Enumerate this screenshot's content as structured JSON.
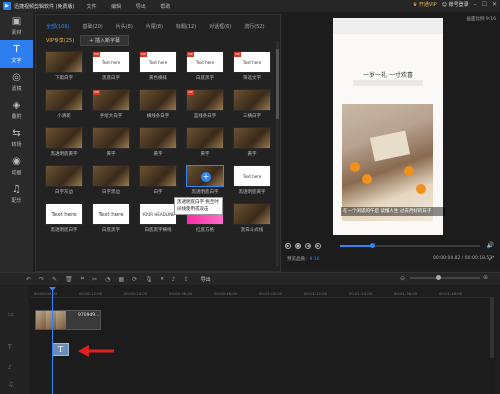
{
  "window": {
    "title": "迅捷视频剪辑软件 (免费版)",
    "menu": [
      "文件",
      "编辑",
      "导出",
      "帮助"
    ],
    "vip_label": "开通VIP",
    "login_label": "账号登录",
    "ratio_label": "画面比例 9:16"
  },
  "sidebar": {
    "items": [
      {
        "label": "素材",
        "icon": "folder-icon",
        "active": false
      },
      {
        "label": "文字",
        "icon": "text-icon",
        "active": true
      },
      {
        "label": "滤镜",
        "icon": "filter-icon",
        "active": false
      },
      {
        "label": "叠附",
        "icon": "overlay-icon",
        "active": false
      },
      {
        "label": "转场",
        "icon": "transition-icon",
        "active": false
      },
      {
        "label": "动画",
        "icon": "animation-icon",
        "active": false
      },
      {
        "label": "配乐",
        "icon": "music-icon",
        "active": false
      }
    ]
  },
  "panel": {
    "tabs": [
      {
        "label": "全部(106)",
        "active": true
      },
      {
        "label": "基础(20)",
        "active": false
      },
      {
        "label": "片头(8)",
        "active": false
      },
      {
        "label": "片尾(8)",
        "active": false
      },
      {
        "label": "标题(12)",
        "active": false
      },
      {
        "label": "对话框(6)",
        "active": false
      },
      {
        "label": "流行(52)",
        "active": false
      }
    ],
    "vip_chip": "VIP专享(25)",
    "add_button": "+ 插入新字幕",
    "items": [
      {
        "caption": "下雨白字",
        "style": "photo",
        "overlay": "",
        "vip": false
      },
      {
        "caption": "黑底白字",
        "style": "white",
        "overlay": "Text here",
        "vip": true
      },
      {
        "caption": "黄色横排",
        "style": "white",
        "overlay": "Text here",
        "vip": true
      },
      {
        "caption": "白底黑字",
        "style": "white",
        "overlay": "Text here",
        "vip": true
      },
      {
        "caption": "筛选文字",
        "style": "white",
        "overlay": "Text here",
        "vip": true
      },
      {
        "caption": "小清新",
        "style": "photo",
        "overlay": "",
        "vip": false
      },
      {
        "caption": "手绘大白字",
        "style": "photo",
        "overlay": "",
        "vip": true
      },
      {
        "caption": "横线条白字",
        "style": "photo",
        "overlay": "",
        "vip": false
      },
      {
        "caption": "蓝线条白字",
        "style": "photo",
        "overlay": "",
        "vip": true
      },
      {
        "caption": "三横白字",
        "style": "photo",
        "overlay": "",
        "vip": false
      },
      {
        "caption": "黑透明底黄字",
        "style": "photo",
        "overlay": "",
        "vip": false
      },
      {
        "caption": "黄字",
        "style": "photo",
        "overlay": "",
        "vip": false
      },
      {
        "caption": "黄字",
        "style": "photo",
        "overlay": "",
        "vip": false
      },
      {
        "caption": "黄字",
        "style": "photo",
        "overlay": "",
        "vip": false
      },
      {
        "caption": "黄字",
        "style": "photo",
        "overlay": "",
        "vip": false
      },
      {
        "caption": "白字灰边",
        "style": "photo",
        "overlay": "",
        "vip": false
      },
      {
        "caption": "白字黑边",
        "style": "photo",
        "overlay": "",
        "vip": false
      },
      {
        "caption": "白字",
        "style": "photo",
        "overlay": "",
        "vip": false
      },
      {
        "caption": "黑透明底白字",
        "style": "photo",
        "overlay": "",
        "vip": false,
        "selected": true
      },
      {
        "caption": "黑透明底黄字",
        "style": "white",
        "overlay": "Text here",
        "vip": false
      },
      {
        "caption": "黑透明底白字",
        "style": "white",
        "overlay": "Text here",
        "vip": false,
        "big": true
      },
      {
        "caption": "白底黑字",
        "style": "white",
        "overlay": "Text here",
        "vip": false,
        "big": true
      },
      {
        "caption": "白底黑字横线",
        "style": "white",
        "overlay": "YOUR HEADLINE HERE",
        "vip": false
      },
      {
        "caption": "红底方格",
        "style": "pink",
        "overlay": "",
        "vip": false
      },
      {
        "caption": "黑白斗式线",
        "style": "photo",
        "overlay": "",
        "vip": false
      }
    ],
    "tooltip": "黑透明底白字 拖至时间线使用或双击"
  },
  "preview": {
    "title": "一岁一礼 一寸欢喜",
    "caption": "在一个闲适的午后 读懂人生 过去月好的日子",
    "time_current": "00:00:04.82",
    "time_total": "00:00:18.53",
    "quality_label": "预览品质：",
    "quality_value": "9:16",
    "progress_fraction": 0.23
  },
  "toolbar": {
    "export_label": "导出"
  },
  "timeline": {
    "ticks": [
      "00:00:00.00",
      "00:00:12.00",
      "00:00:24.00",
      "00:00:36.00",
      "00:00:48.00",
      "00:01:00.00",
      "00:01:12.00",
      "00:01:24.00",
      "00:01:36.00",
      "00:01:48.00"
    ],
    "video_clip_label": "9709d9...",
    "text_clip_label": "T"
  }
}
